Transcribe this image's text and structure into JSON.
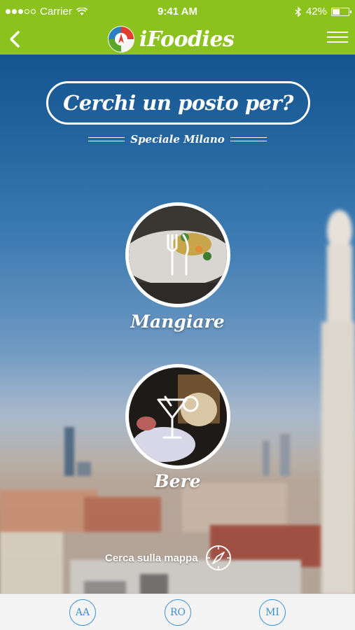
{
  "status_bar": {
    "carrier": "Carrier",
    "time": "9:41 AM",
    "battery": "42%",
    "battery_level": 0.42
  },
  "navbar": {
    "app_name": "iFoodies",
    "back_icon": "chevron-left-icon",
    "menu_icon": "hamburger-menu-icon"
  },
  "header": {
    "title": "Cerchi un posto per?",
    "subtitle": "Speciale Milano"
  },
  "categories": [
    {
      "label": "Mangiare",
      "icon": "fork-knife-icon"
    },
    {
      "label": "Bere",
      "icon": "cocktail-icon"
    }
  ],
  "map_search": {
    "label": "Cerca sulla mappa",
    "icon": "compass-icon"
  },
  "bottom_bar": {
    "cities": [
      "AA",
      "RO",
      "MI"
    ]
  },
  "colors": {
    "accent_green": "#8cc21e",
    "city_button_blue": "#3d8fd6"
  }
}
